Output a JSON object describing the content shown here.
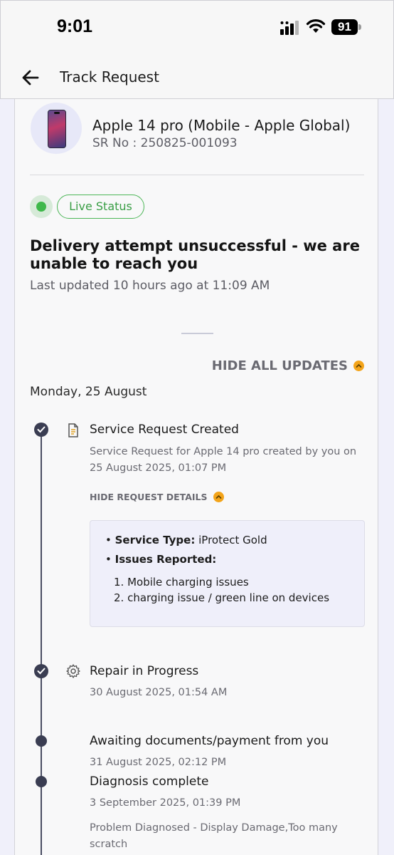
{
  "status_bar": {
    "time": "9:01",
    "battery": "91"
  },
  "header": {
    "title": "Track Request"
  },
  "device": {
    "name": "Apple 14 pro (Mobile - Apple Global)",
    "sr_number": "SR No : 250825-001093"
  },
  "live_status": {
    "label": "Live Status",
    "color": "#3eb84a"
  },
  "status": {
    "headline": "Delivery attempt unsuccessful - we are unable to reach you",
    "last_updated": "Last updated 10 hours ago at 11:09 AM"
  },
  "updates": {
    "toggle_label": "HIDE ALL UPDATES",
    "date_header": "Monday, 25 August"
  },
  "events": [
    {
      "title": "Service Request Created",
      "subtitle": "Service Request for Apple 14 pro created by you on 25 August 2025, 01:07 PM",
      "icon": "document-icon",
      "details_toggle": "HIDE REQUEST DETAILS",
      "details": {
        "service_type_label": "Service Type:",
        "service_type_value": "iProtect Gold",
        "issues_label": "Issues Reported:",
        "issues": [
          "1. Mobile charging issues",
          "2. charging issue / green line on  devices"
        ]
      }
    },
    {
      "title": "Repair in Progress",
      "subtitle": "30 August 2025, 01:54 AM",
      "icon": "gear-icon"
    },
    {
      "title": "Awaiting documents/payment from you",
      "subtitle": "31 August 2025, 02:12 PM"
    },
    {
      "title": "Diagnosis complete",
      "subtitle": "3 September 2025, 01:39 PM",
      "note": "Problem Diagnosed - Display Damage,Too many scratch"
    }
  ],
  "colors": {
    "accent_orange": "#f3a41a",
    "timeline": "#3a3d52",
    "live_green": "#3eb84a"
  }
}
